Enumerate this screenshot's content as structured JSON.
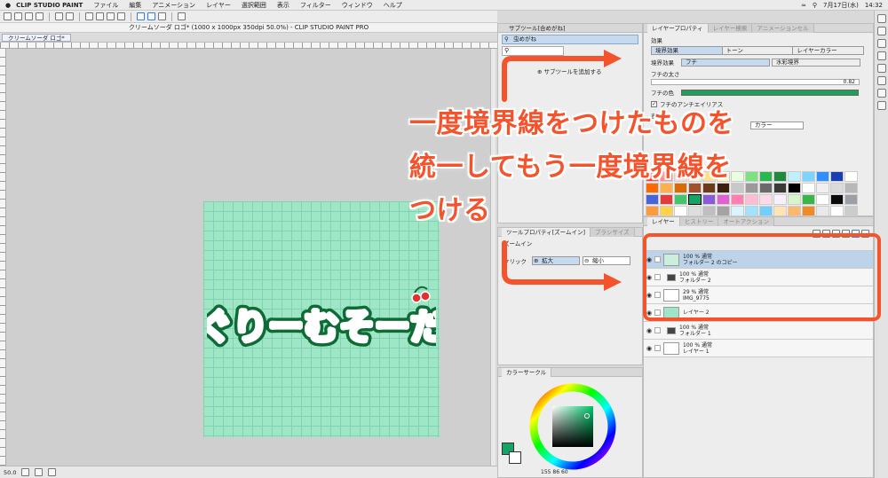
{
  "menubar": {
    "apple": "",
    "app_name": "CLIP STUDIO PAINT",
    "items": [
      "ファイル",
      "編集",
      "アニメーション",
      "レイヤー",
      "選択範囲",
      "表示",
      "フィルター",
      "ウィンドウ",
      "ヘルプ"
    ],
    "date": "7月17日(水)",
    "time": "14:32"
  },
  "document": {
    "title": "クリームソーダ ロゴ* (1000 x 1000px 350dpi 50.0%) - CLIP STUDIO PAINT PRO",
    "tab": "クリームソーダ ロゴ*"
  },
  "canvas": {
    "logo_text": "ぐりーむそーだ",
    "bg_color": "#9ee6c6",
    "logo_fill": "#33cc66",
    "logo_outline": "#0f6b35"
  },
  "status": {
    "zoom": "50.0"
  },
  "subtool_panel": {
    "title": "サブツール[合めがね]",
    "tool": "虫めがね",
    "add_label": "サブツールを追加する"
  },
  "layer_property": {
    "tabs": [
      "レイヤープロパティ",
      "レイヤー検索",
      "アニメーションセル"
    ],
    "effect_label": "効果",
    "effects": [
      "境界効果",
      "トーン",
      "レイヤーカラー"
    ],
    "border_label": "境界効果",
    "border_opts": [
      "フチ",
      "水彩境界"
    ],
    "width_label": "フチの太さ",
    "width_value": "0.82",
    "color_label": "フチの色",
    "border_color": "#1fa05a",
    "antialias_label": "フチのアンチエイリアス",
    "expr_label": "表現色",
    "expr_value": "カラー"
  },
  "tool_property": {
    "tabs": [
      "ツールプロパティ[ズームイン]",
      "ブラシサイズ"
    ],
    "sub": "ズームイン",
    "click_label": "クリック",
    "zoom_in": "拡大",
    "zoom_out": "縮小"
  },
  "layers_panel": {
    "tabs": [
      "レイヤー",
      "ヒストリー",
      "オートアクション"
    ],
    "layers": [
      {
        "mode": "100 % 通常",
        "name": "フォルダー 2 のコピー",
        "selected": true,
        "kind": "layer"
      },
      {
        "mode": "100 % 通常",
        "name": "フォルダー 2",
        "selected": false,
        "kind": "folder"
      },
      {
        "mode": "29 % 通常",
        "name": "IMG_9775",
        "selected": false,
        "kind": "image"
      },
      {
        "mode": "",
        "name": "レイヤー 2",
        "selected": false,
        "kind": "fill"
      },
      {
        "mode": "100 % 通常",
        "name": "フォルダー 1",
        "selected": false,
        "kind": "folder"
      },
      {
        "mode": "100 % 通常",
        "name": "レイヤー 1",
        "selected": false,
        "kind": "white"
      }
    ]
  },
  "color_panel": {
    "title": "カラーサークル",
    "h": "155",
    "s": "86",
    "v": "60",
    "main_color": "#17a365"
  },
  "swatches": [
    "#ff2d2d",
    "#ff8a8a",
    "#ffd5d5",
    "#ffecd1",
    "#ffe08a",
    "#fff9b0",
    "#e8ffe0",
    "#7ee07e",
    "#28b84f",
    "#1f8a3e",
    "#bff0ff",
    "#7ad6ff",
    "#2f8fff",
    "#1a3fb0",
    "#ffffff",
    "#ff6a00",
    "#ffb04a",
    "#d96b00",
    "#a0522d",
    "#6b3b1a",
    "#3a200e",
    "#c8c8c8",
    "#9a9a9a",
    "#6a6a6a",
    "#3a3a3a",
    "#000000",
    "#ffffff",
    "#f0f0f0",
    "#dadada",
    "#b8b8b8",
    "#4b63d8",
    "#e23b3b",
    "#44c46d",
    "#17a365",
    "#8a5bd6",
    "#e05fd1",
    "#ff7fb0",
    "#ffbdd3",
    "#ffd9ea",
    "#f6f0ff",
    "#d6f5c9",
    "#39b54a",
    "#ffffff",
    "#0a0a0a",
    "#9aa0a6",
    "#ff9a3c",
    "#ffd24a",
    "#ffffff",
    "#dedede",
    "#bfbfbf",
    "#a3a3a3",
    "#d9f4ff",
    "#9fe3ff",
    "#6fcfff",
    "#ffe3b3",
    "#ffb86b",
    "#f08a24",
    "#e9e9e9",
    "#ffffff",
    "#cccccc"
  ],
  "annotation": {
    "line1": "一度境界線をつけたものを",
    "line2": "統一してもう一度境界線を",
    "line3": "つける",
    "color": "#f4532c"
  }
}
